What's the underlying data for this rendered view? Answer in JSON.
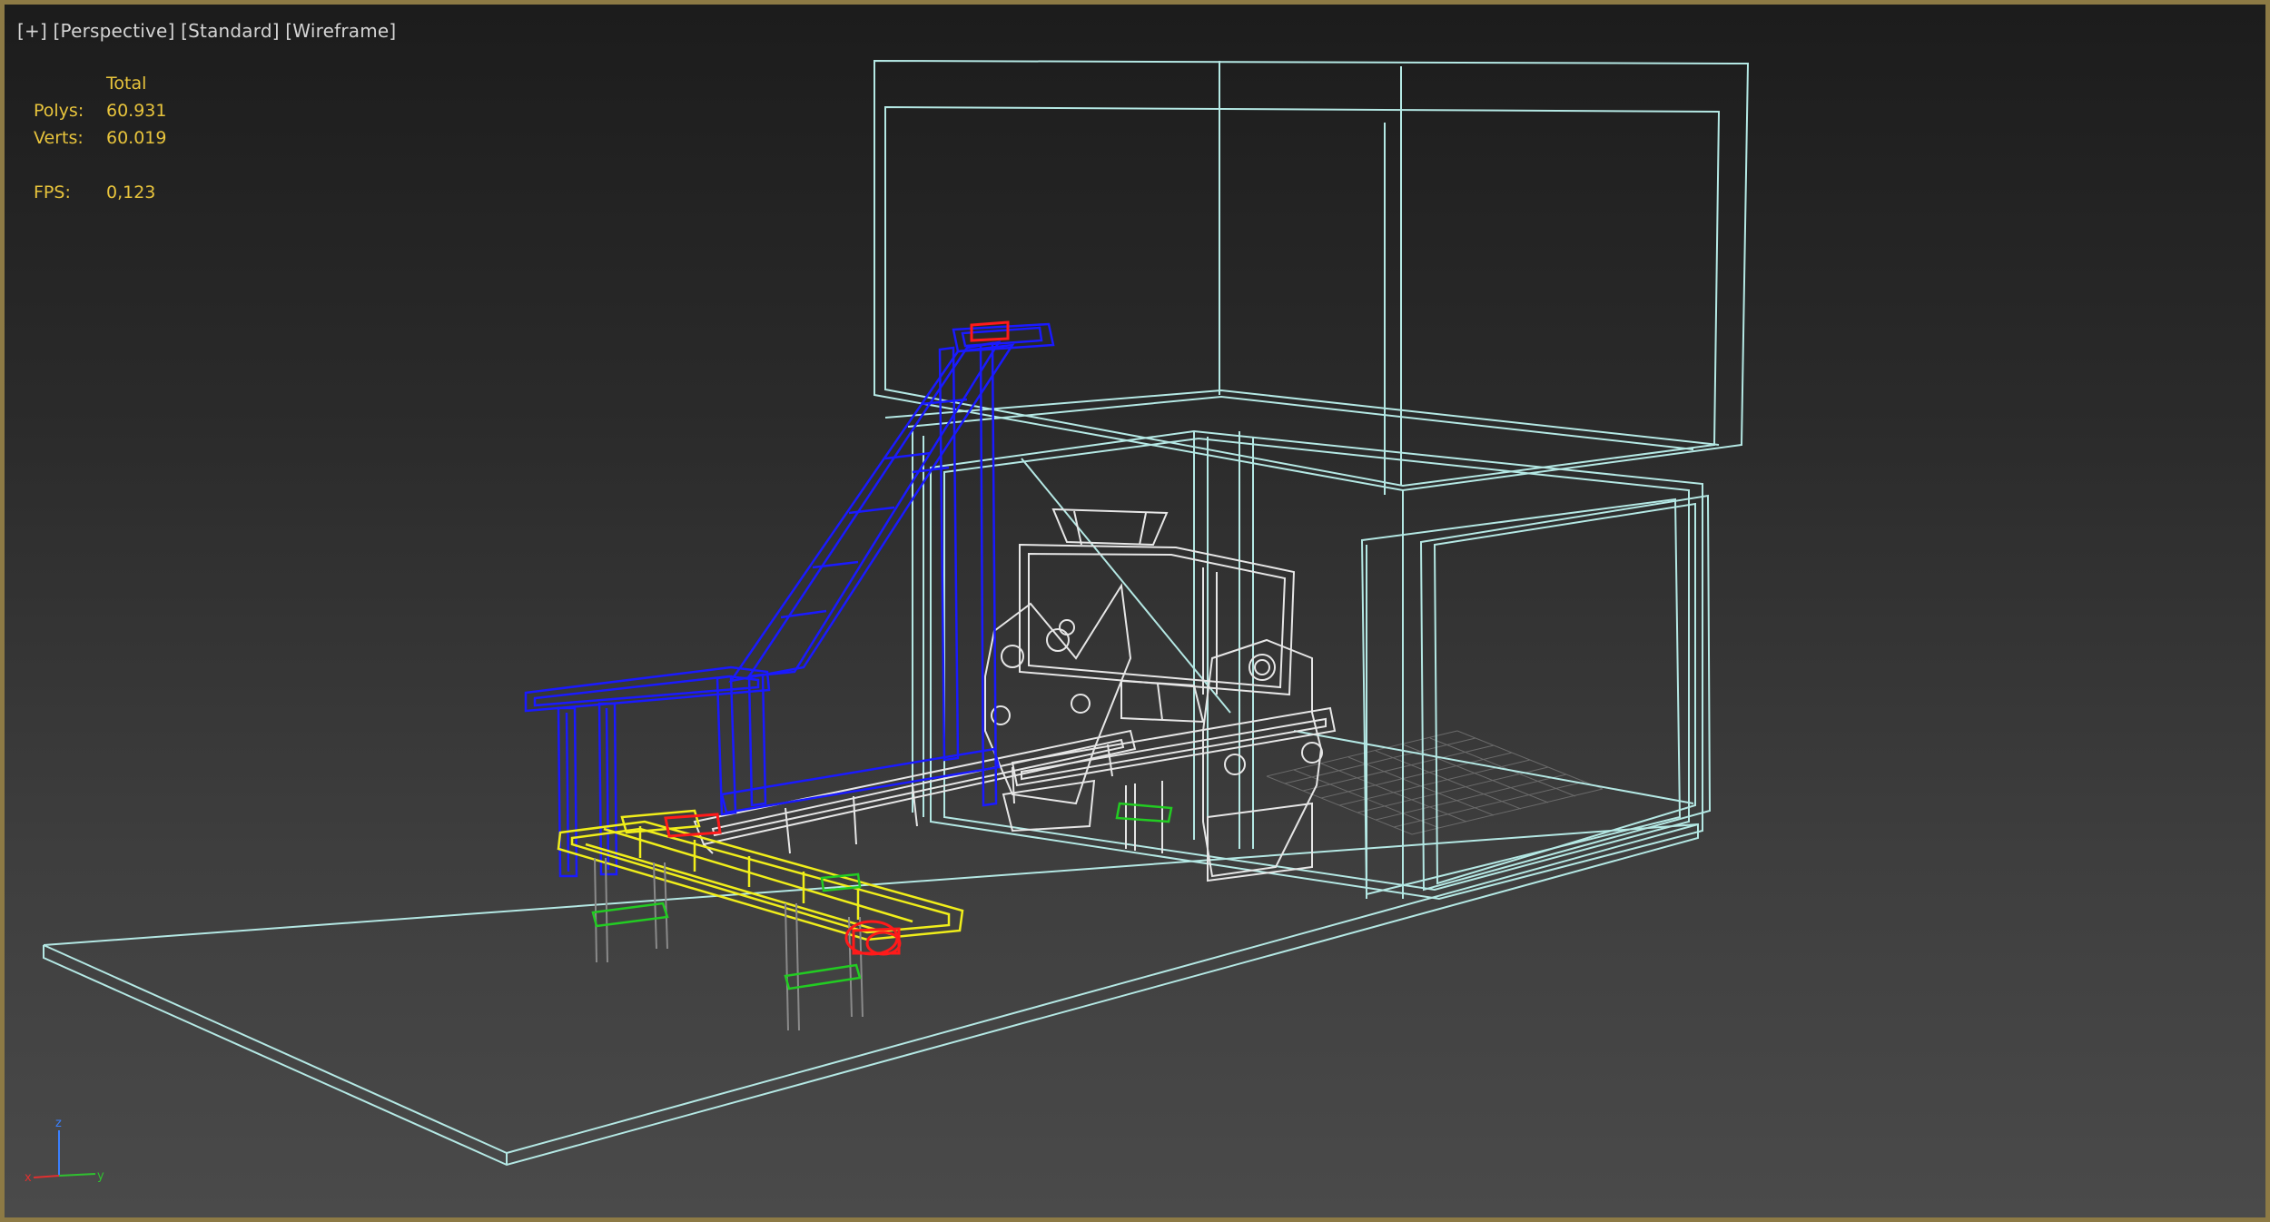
{
  "viewport": {
    "labels": {
      "plus": "[+]",
      "view": "[Perspective]",
      "shading_style": "[Standard]",
      "render_mode": "[Wireframe]"
    },
    "stats": {
      "header": "Total",
      "polys_label": "Polys:",
      "polys_value": "60.931",
      "verts_label": "Verts:",
      "verts_value": "60.019",
      "fps_label": "FPS:",
      "fps_value": "0,123"
    },
    "axis_labels": {
      "x": "x",
      "y": "y",
      "z": "z"
    }
  },
  "colors": {
    "frame_border": "#8d7a45",
    "stats_text": "#e8c43c",
    "label_text": "#d4d4d4",
    "enclosure_wire": "#b4e8e4",
    "incline_conveyor": "#1a1aff",
    "feeder_conveyor": "#f0ee1a",
    "machine_body": "#e6e6e6",
    "motor": "#ff1a1a",
    "feet": "#22cc22",
    "grid": "#6a6a6a",
    "axis_x": "#e03030",
    "axis_y": "#30c030",
    "axis_z": "#3a80ff"
  }
}
